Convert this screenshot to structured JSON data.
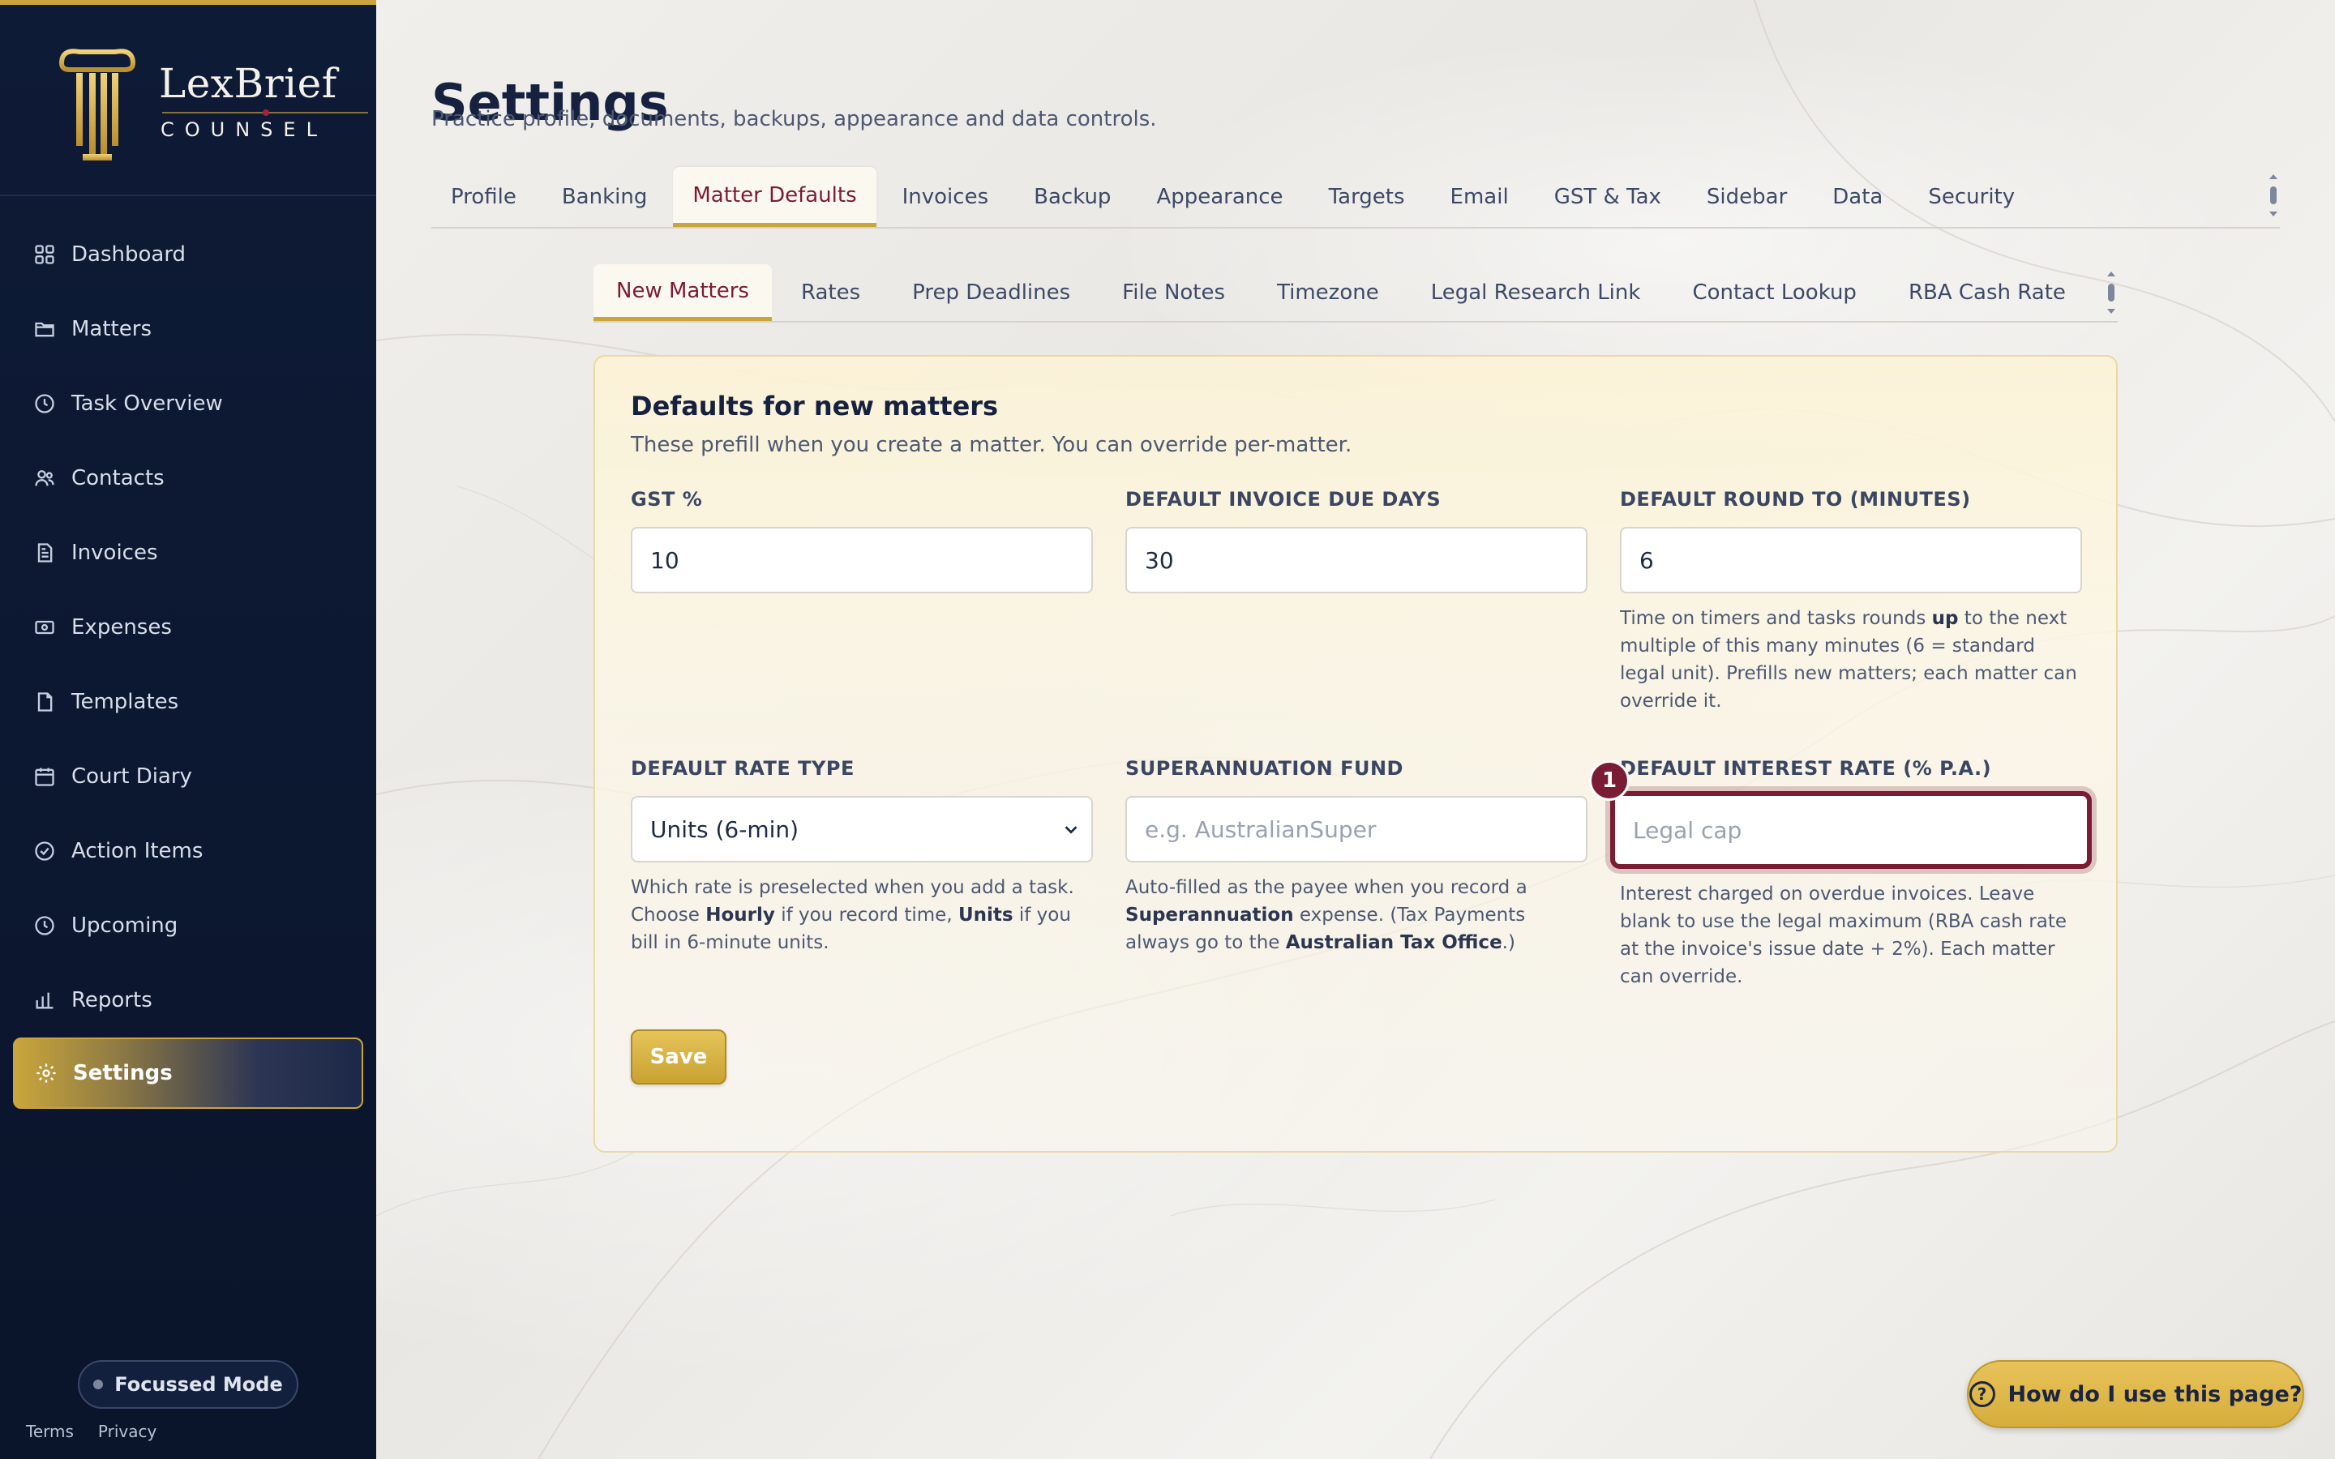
{
  "brand": {
    "name": "LexBrief",
    "sub": "COUNSEL"
  },
  "sidebar": {
    "items": [
      {
        "label": "Dashboard",
        "icon": "grid-icon"
      },
      {
        "label": "Matters",
        "icon": "folder-icon"
      },
      {
        "label": "Task Overview",
        "icon": "clock-icon"
      },
      {
        "label": "Contacts",
        "icon": "users-icon"
      },
      {
        "label": "Invoices",
        "icon": "invoice-icon"
      },
      {
        "label": "Expenses",
        "icon": "money-icon"
      },
      {
        "label": "Templates",
        "icon": "document-icon"
      },
      {
        "label": "Court Diary",
        "icon": "calendar-icon"
      },
      {
        "label": "Action Items",
        "icon": "check-circle-icon"
      },
      {
        "label": "Upcoming",
        "icon": "clock-icon"
      },
      {
        "label": "Reports",
        "icon": "bar-chart-icon"
      },
      {
        "label": "Settings",
        "icon": "gear-icon",
        "active": true
      }
    ],
    "focus_mode": "Focussed Mode",
    "footer": {
      "terms": "Terms",
      "privacy": "Privacy"
    }
  },
  "page": {
    "title": "Settings",
    "subtitle": "Practice profile, documents, backups, appearance and data controls."
  },
  "tabs": [
    "Profile",
    "Banking",
    "Matter Defaults",
    "Invoices",
    "Backup",
    "Appearance",
    "Targets",
    "Email",
    "GST & Tax",
    "Sidebar",
    "Data",
    "Security"
  ],
  "active_tab": "Matter Defaults",
  "subtabs": [
    "New Matters",
    "Rates",
    "Prep Deadlines",
    "File Notes",
    "Timezone",
    "Legal Research Link",
    "Contact Lookup",
    "RBA Cash Rate"
  ],
  "active_subtab": "New Matters",
  "card": {
    "title": "Defaults for new matters",
    "subtitle": "These prefill when you create a matter. You can override per-matter.",
    "fields": {
      "gst": {
        "label": "GST %",
        "value": "10"
      },
      "due_days": {
        "label": "DEFAULT INVOICE DUE DAYS",
        "value": "30"
      },
      "round_to": {
        "label": "DEFAULT ROUND TO (MINUTES)",
        "value": "6",
        "help_a": "Time on timers and tasks rounds ",
        "help_b": "up",
        "help_c": " to the next multiple of this many minutes (6 = standard legal unit). Prefills new matters; each matter can override it."
      },
      "rate_type": {
        "label": "DEFAULT RATE TYPE",
        "value": "Units (6-min)",
        "help_a": "Which rate is preselected when you add a task. Choose ",
        "help_b": "Hourly",
        "help_c": " if you record time, ",
        "help_d": "Units",
        "help_e": " if you bill in 6-minute units."
      },
      "super_fund": {
        "label": "SUPERANNUATION FUND",
        "placeholder": "e.g. AustralianSuper",
        "help_a": "Auto-filled as the payee when you record a ",
        "help_b": "Superannuation",
        "help_c": " expense. (Tax Payments always go to the ",
        "help_d": "Australian Tax Office",
        "help_e": ".)"
      },
      "interest_rate": {
        "label": "DEFAULT INTEREST RATE (% P.A.)",
        "placeholder": "Legal cap",
        "badge": "1",
        "help": "Interest charged on overdue invoices. Leave blank to use the legal maximum (RBA cash rate at the invoice's issue date + 2%). Each matter can override."
      }
    },
    "save_label": "Save"
  },
  "help_button": "How do I use this page?",
  "colors": {
    "navy": "#0e1b36",
    "gold": "#c9a63c",
    "burgundy": "#7a1c33"
  }
}
